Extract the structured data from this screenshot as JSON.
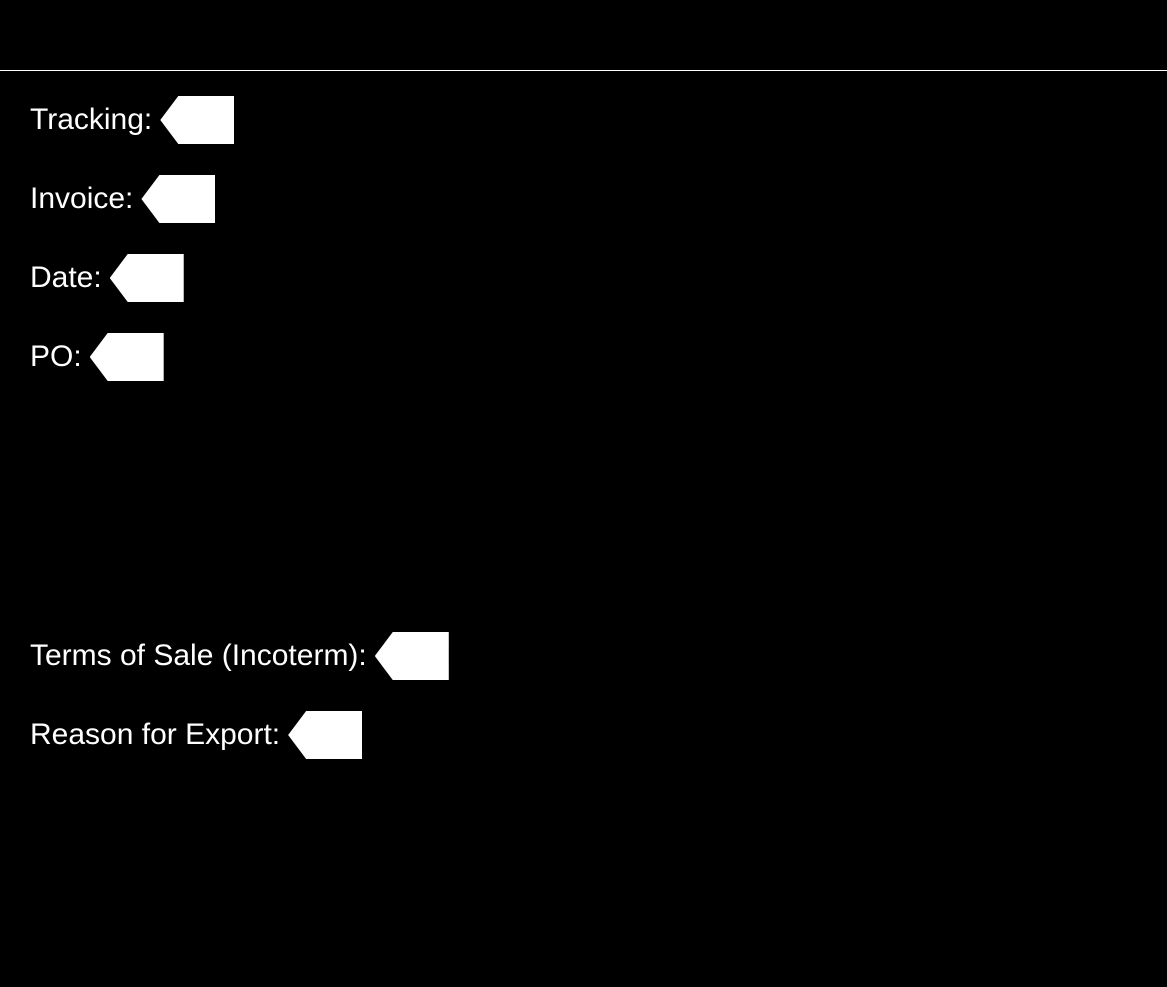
{
  "fields": {
    "tracking": {
      "label": "Tracking:"
    },
    "invoice": {
      "label": "Invoice:"
    },
    "date": {
      "label": "Date:"
    },
    "po": {
      "label": "PO:"
    },
    "terms": {
      "label": "Terms of Sale (Incoterm):"
    },
    "reason": {
      "label": "Reason for Export:"
    }
  }
}
